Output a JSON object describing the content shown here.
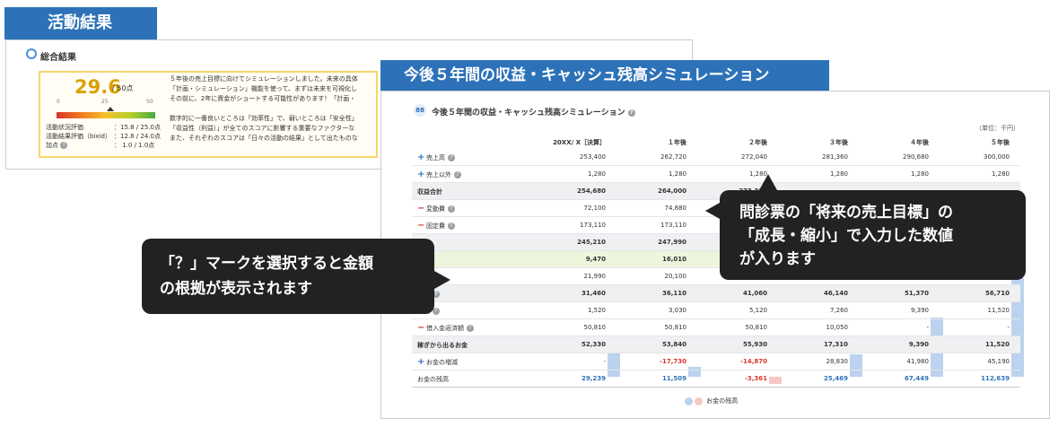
{
  "tags": {
    "result": "活動結果",
    "simulation": "今後５年間の収益・キャッシュ残高シミュレーション"
  },
  "result_panel": {
    "title": "総合結果",
    "score": "29.6",
    "score_of": "/ 50点",
    "scale": [
      "0",
      "25",
      "50"
    ],
    "evals": [
      {
        "label": "活動状況評価",
        "value": "：15.8 / 25.0点"
      },
      {
        "label": "活動結果評価（bixid）",
        "value": "：12.8 / 24.0点"
      },
      {
        "label": "加点",
        "value": "：  1.0 /   1.0点"
      }
    ],
    "comment_lines": [
      "５年後の売上目標に向けてシミュレーションしました。未来の具体",
      "「計画・シミュレーション」機能を使って、まずは未来を可視化し",
      "その前に、2年に資金がショートする可能性があります！「計画・",
      "",
      "数字的に一番良いところは「効率性」で、弱いところは「安全性」",
      "「収益性（利益）」が全てのスコアに影響する重要なファクターな",
      "また、それぞれのスコアは「日々の活動の結果」として出たものな"
    ]
  },
  "sim_panel": {
    "title": "今後５年間の収益・キャッシュ残高シミュレーション",
    "unit": "（単位：千円）",
    "headers": [
      "20XX/ X［決算］",
      "１年後",
      "２年後",
      "３年後",
      "４年後",
      "５年後"
    ],
    "rows": [
      {
        "label": "売上高",
        "sign": "+",
        "help": true,
        "values": [
          "253,400",
          "262,720",
          "272,040",
          "281,360",
          "290,680",
          "300,000"
        ]
      },
      {
        "label": "売上以外",
        "sign": "+",
        "help": true,
        "values": [
          "1,280",
          "1,280",
          "1,280",
          "1,280",
          "1,280",
          "1,280"
        ]
      },
      {
        "label": "収益合計",
        "sum": true,
        "values": [
          "254,680",
          "264,000",
          "273,320",
          "",
          "",
          ""
        ]
      },
      {
        "label": "変動費",
        "sign": "-",
        "help": true,
        "values": [
          "72,100",
          "74,880",
          "77,5",
          "",
          "",
          ""
        ]
      },
      {
        "label": "固定費",
        "sign": "-",
        "help": true,
        "values": [
          "173,110",
          "173,110",
          "173,110",
          "",
          "",
          ""
        ]
      },
      {
        "label": "",
        "sum": true,
        "values": [
          "245,210",
          "247,990",
          "250,6",
          "",
          "",
          ""
        ]
      },
      {
        "label": "",
        "hl": true,
        "values": [
          "9,470",
          "16,010",
          "22,6",
          "",
          "",
          ""
        ]
      },
      {
        "label": "用",
        "help": true,
        "values": [
          "21,990",
          "20,100",
          "18,3",
          "",
          "",
          ""
        ]
      },
      {
        "label": "お金",
        "sum": true,
        "help": true,
        "values": [
          "31,460",
          "36,110",
          "41,060",
          "46,140",
          "51,370",
          "56,710"
        ]
      },
      {
        "label": "支払",
        "help": true,
        "values": [
          "1,520",
          "3,030",
          "5,120",
          "7,260",
          "9,390",
          "11,520"
        ]
      },
      {
        "label": "借入金返済額",
        "sign": "-",
        "help": true,
        "values": [
          "50,810",
          "50,810",
          "50,810",
          "10,050",
          "-",
          "-"
        ]
      },
      {
        "label": "稼ぎから出るお金",
        "sum": true,
        "values": [
          "52,330",
          "53,840",
          "55,930",
          "17,310",
          "9,390",
          "11,520"
        ]
      },
      {
        "label": "お金の増減",
        "sign": "+",
        "values": [
          "-",
          "-17,730",
          "-14,870",
          "28,830",
          "41,980",
          "45,190"
        ]
      },
      {
        "label": "お金の残高",
        "total": true,
        "values": [
          "29,239",
          "11,509",
          "-3,361",
          "25,469",
          "67,449",
          "112,639"
        ]
      }
    ],
    "legend": "お金の残高",
    "legend_colors": [
      "#bcd2ee",
      "#f6c9c4"
    ]
  },
  "chart_data": {
    "type": "bar",
    "categories": [
      "20XX/ X［決算］",
      "１年後",
      "２年後",
      "３年後",
      "４年後",
      "５年後"
    ],
    "series": [
      {
        "name": "お金の残高",
        "values": [
          29239,
          11509,
          -3361,
          25469,
          67449,
          112639
        ]
      }
    ]
  },
  "bubbles": {
    "left": [
      "「？」マークを選択すると金額",
      "の根拠が表示されます"
    ],
    "right": [
      "問診票の「将来の売上目標」の",
      "「成長・縮小」で入力した数値",
      "が入ります"
    ]
  }
}
